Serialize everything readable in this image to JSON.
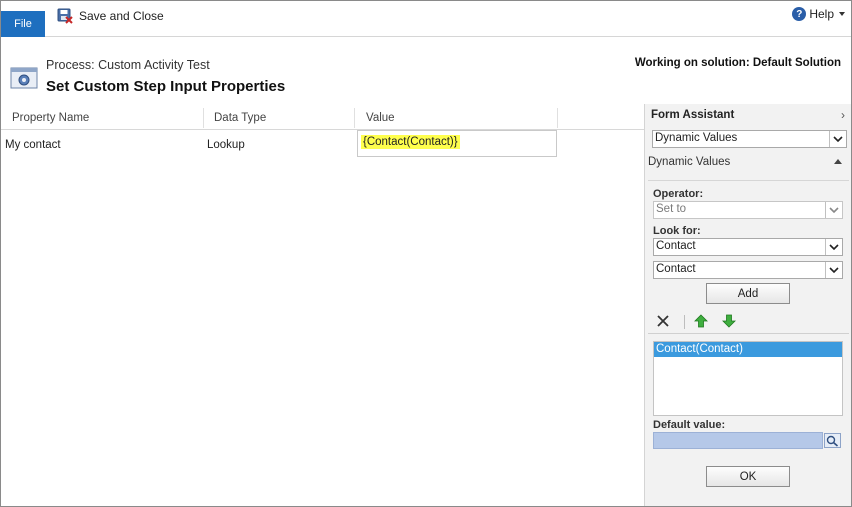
{
  "ribbon": {
    "file_label": "File",
    "save_close_label": "Save and Close",
    "help_label": "Help"
  },
  "header": {
    "process_line": "Process: Custom Activity Test",
    "title": "Set Custom Step Input Properties",
    "solution": "Working on solution: Default Solution"
  },
  "grid": {
    "columns": [
      "Property Name",
      "Data Type",
      "Value"
    ],
    "rows": [
      {
        "property_name": "My contact",
        "data_type": "Lookup",
        "value": "{Contact(Contact)}"
      }
    ]
  },
  "form_assistant": {
    "title": "Form Assistant",
    "mode_select": "Dynamic Values",
    "section_label": "Dynamic Values",
    "operator_label": "Operator:",
    "operator_value": "Set to",
    "look_for_label": "Look for:",
    "look_for_entity": "Contact",
    "look_for_field": "Contact",
    "add_label": "Add",
    "list_items": [
      "Contact(Contact)"
    ],
    "default_value_label": "Default value:",
    "ok_label": "OK"
  },
  "colors": {
    "file_tab": "#1e6fbf",
    "highlight": "#ffff4d",
    "selected_item": "#3b9ade",
    "default_field": "#b5c8e8"
  }
}
